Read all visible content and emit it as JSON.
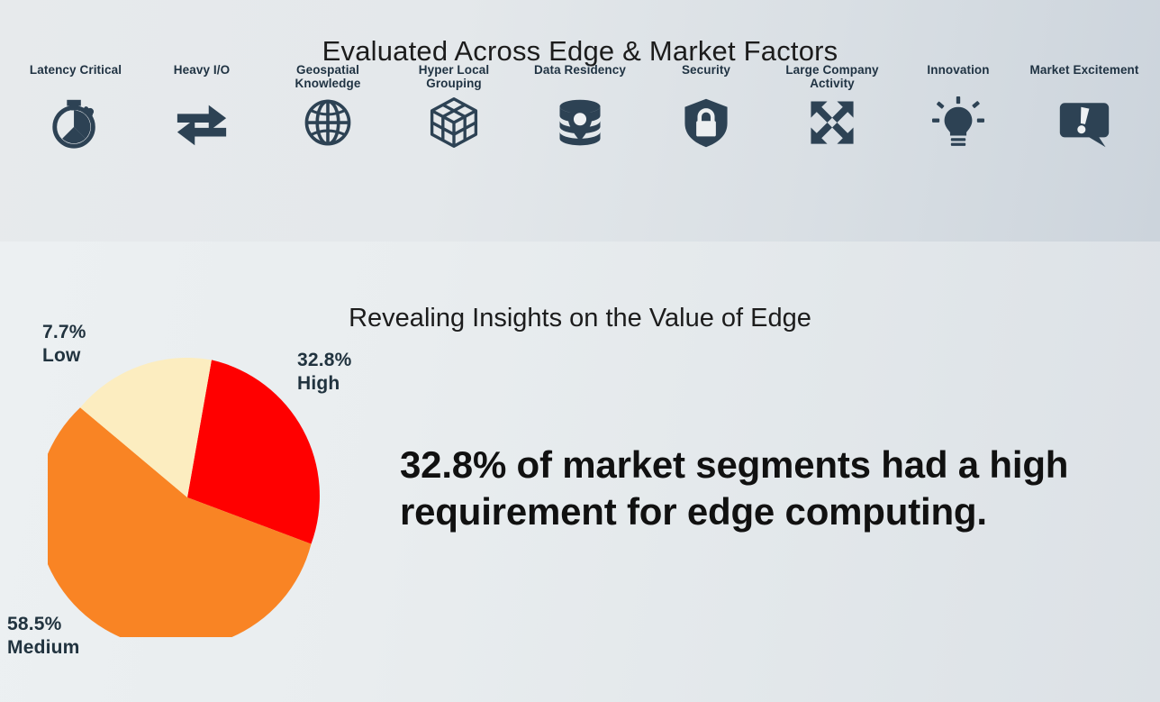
{
  "top_panel": {
    "title": "Evaluated Across Edge & Market Factors",
    "factors": [
      {
        "label": "Latency Critical",
        "icon": "stopwatch-icon"
      },
      {
        "label": "Heavy I/O",
        "icon": "bidirectional-arrows-icon"
      },
      {
        "label": "Geospatial\nKnowledge",
        "icon": "globe-icon"
      },
      {
        "label": "Hyper Local Grouping",
        "icon": "cube-grid-icon"
      },
      {
        "label": "Data Residency",
        "icon": "database-location-pin-icon"
      },
      {
        "label": "Security",
        "icon": "shield-lock-icon"
      },
      {
        "label": "Large Company\nActivity",
        "icon": "expand-arrows-icon"
      },
      {
        "label": "Innovation",
        "icon": "lightbulb-icon"
      },
      {
        "label": "Market Excitement",
        "icon": "speech-bubble-exclamation-icon"
      }
    ]
  },
  "bottom_panel": {
    "title": "Revealing Insights on the Value of Edge",
    "headline": "32.8% of market segments had a high requirement for edge computing.",
    "labels": {
      "low": "7.7%\nLow",
      "high": "32.8%\nHigh",
      "medium": "58.5%\nMedium"
    }
  },
  "colors": {
    "high": "#FF0000",
    "medium": "#F98424",
    "low": "#FCEDC0",
    "icon": "#2D4254",
    "text_dark": "#21333F"
  },
  "chart_data": {
    "type": "pie",
    "title": "Revealing Insights on the Value of Edge",
    "categories": [
      "High",
      "Medium",
      "Low"
    ],
    "values": [
      32.8,
      58.5,
      7.7
    ],
    "unit": "%",
    "colors": [
      "#FF0000",
      "#F98424",
      "#FCEDC0"
    ],
    "labels": [
      "32.8%\nHigh",
      "58.5%\nMedium",
      "7.7%\nLow"
    ],
    "legend": "none",
    "start_angle_deg": -10,
    "direction": "clockwise"
  }
}
